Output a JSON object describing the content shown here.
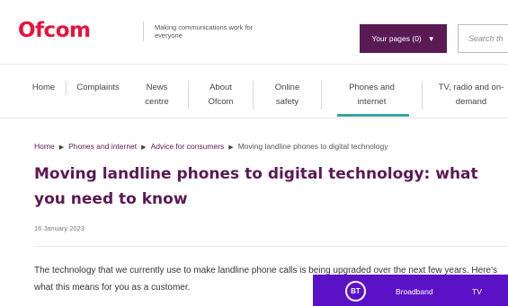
{
  "header": {
    "logo_text": "Ofcom",
    "tagline": "Making communications work for everyone",
    "your_pages_label": "Your pages (0)",
    "search_placeholder": "Search th"
  },
  "nav": {
    "items": [
      {
        "label": "Home"
      },
      {
        "label": "Complaints"
      },
      {
        "label": "News centre"
      },
      {
        "label": "About Ofcom"
      },
      {
        "label": "Online safety"
      },
      {
        "label": "Phones and internet",
        "active": true
      },
      {
        "label": "TV, radio and on-demand"
      }
    ],
    "active_color": "#35a2a7"
  },
  "breadcrumb": {
    "items": [
      "Home",
      "Phones and internet",
      "Advice for consumers",
      "Moving landline phones to digital technology"
    ]
  },
  "article": {
    "title": "Moving landline phones to digital technology: what you need to know",
    "date": "16 January 2023",
    "intro": "The technology that we currently use to make landline phone calls is being upgraded over the next few years. Here's what this means for you as a customer."
  },
  "promo": {
    "logo": "BT",
    "links": [
      "Broadband",
      "TV"
    ],
    "background": "#5b12c7"
  },
  "colors": {
    "brand_red": "#e6133c",
    "brand_purple": "#5a1a53"
  }
}
